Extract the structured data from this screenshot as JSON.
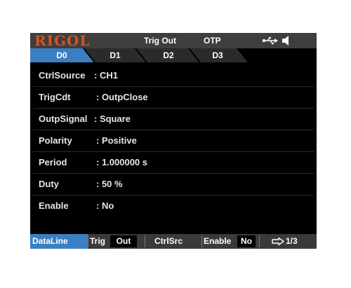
{
  "colors": {
    "brand": "#d7541d",
    "active_tab": "#3a7fc2",
    "active_softkey": "#3a7fc2",
    "statusbar_bg": "#3e3e3e",
    "screen_bg": "#000000"
  },
  "statusbar": {
    "logo": "RIGOL",
    "mode": "Trig Out",
    "protection": "OTP",
    "usb_icon": "usb-icon",
    "speaker_icon": "speaker-icon"
  },
  "tabs": [
    {
      "label": "D0",
      "active": true
    },
    {
      "label": "D1",
      "active": false
    },
    {
      "label": "D2",
      "active": false
    },
    {
      "label": "D3",
      "active": false
    }
  ],
  "params": [
    {
      "label": "CtrlSource",
      "value": ": CH1"
    },
    {
      "label": "TrigCdt",
      "value": ": OutpClose"
    },
    {
      "label": "OutpSignal",
      "value": ": Square"
    },
    {
      "label": "Polarity",
      "value": ": Positive"
    },
    {
      "label": "Period",
      "value": ": 1.000000 s"
    },
    {
      "label": "Duty",
      "value": ": 50 %"
    },
    {
      "label": "Enable",
      "value": ": No"
    }
  ],
  "softkeys": {
    "dataline": "DataLine",
    "trig_label": "Trig",
    "trig_value": "Out",
    "ctrlsrc": "CtrlSrc",
    "enable_label": "Enable",
    "enable_value": "No",
    "page": "1/3",
    "page_icon": "arrow-right-icon"
  }
}
